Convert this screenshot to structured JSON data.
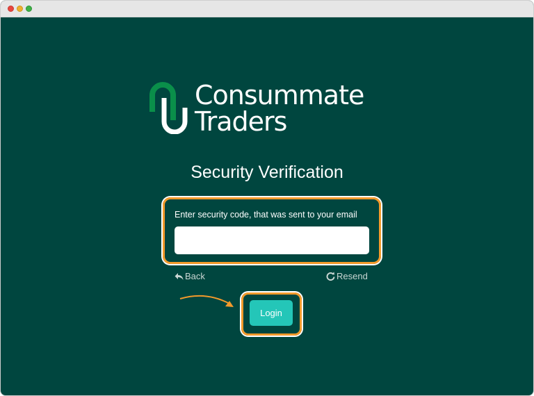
{
  "brand": {
    "line1": "Consummate",
    "line2": "Traders"
  },
  "page": {
    "title": "Security Verification"
  },
  "form": {
    "code_label": "Enter security code, that was sent to your email",
    "code_value": "",
    "back_label": "Back",
    "resend_label": "Resend",
    "login_label": "Login"
  },
  "colors": {
    "background": "#00463f",
    "accent": "#24c6b8",
    "highlight": "#f39a2b",
    "logo_green": "#0a8f4a"
  },
  "icons": {
    "back": "back-arrow-icon",
    "resend": "refresh-icon",
    "pointer": "curved-arrow-icon"
  }
}
